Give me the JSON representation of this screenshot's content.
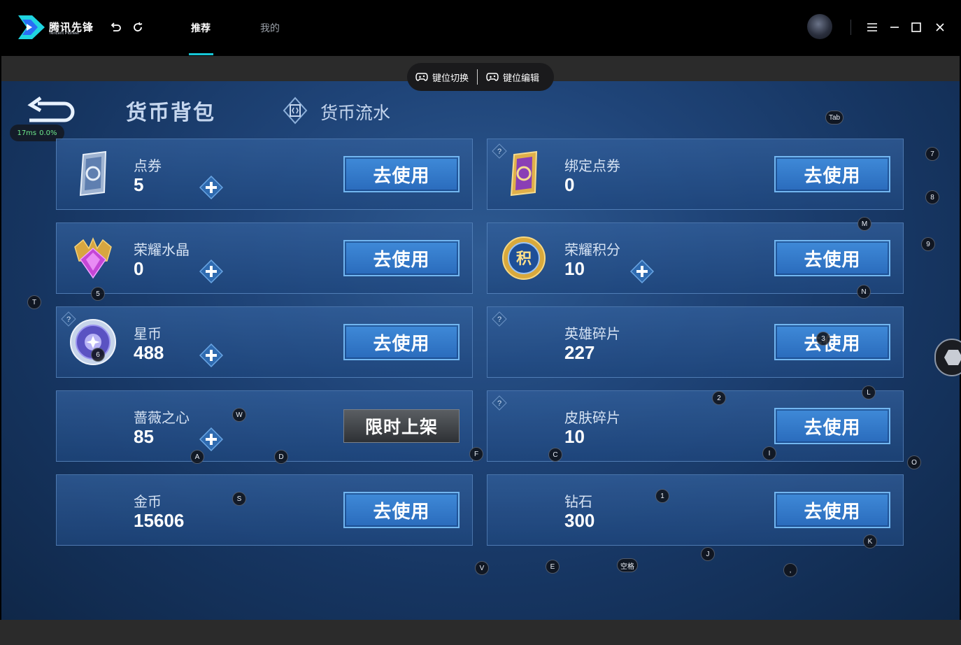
{
  "app": {
    "brand": "腾讯先锋",
    "brand_sub": "Tencent Pioneer",
    "tabs": [
      {
        "label": "推荐",
        "active": true
      },
      {
        "label": "我的",
        "active": false
      }
    ],
    "accent": "#17c6d6"
  },
  "keyctrl": {
    "switch_label": "键位切换",
    "edit_label": "键位编辑"
  },
  "ping": {
    "latency": "17ms",
    "loss": "0.0%"
  },
  "header": {
    "title": "货币背包",
    "flow_tab": "货币流水"
  },
  "currencies": [
    {
      "name": "点券",
      "value": "5",
      "action": "去使用",
      "plus": true,
      "help": false,
      "icon": "voucher-card-icon"
    },
    {
      "name": "绑定点券",
      "value": "0",
      "action": "去使用",
      "plus": false,
      "help": true,
      "icon": "bound-voucher-icon"
    },
    {
      "name": "荣耀水晶",
      "value": "0",
      "action": "去使用",
      "plus": true,
      "help": false,
      "icon": "glory-crystal-icon"
    },
    {
      "name": "荣耀积分",
      "value": "10",
      "action": "去使用",
      "plus": true,
      "help": false,
      "icon": "glory-points-icon"
    },
    {
      "name": "星币",
      "value": "488",
      "action": "去使用",
      "plus": true,
      "help": true,
      "icon": "star-coin-icon"
    },
    {
      "name": "英雄碎片",
      "value": "227",
      "action": "去使用",
      "plus": false,
      "help": true,
      "icon": ""
    },
    {
      "name": "蔷薇之心",
      "value": "85",
      "action": "限时上架",
      "plus": true,
      "help": false,
      "icon": ""
    },
    {
      "name": "皮肤碎片",
      "value": "10",
      "action": "去使用",
      "plus": false,
      "help": true,
      "icon": ""
    },
    {
      "name": "金币",
      "value": "15606",
      "action": "去使用",
      "plus": false,
      "help": false,
      "icon": ""
    },
    {
      "name": "钻石",
      "value": "300",
      "action": "去使用",
      "plus": false,
      "help": false,
      "icon": ""
    }
  ],
  "keys": {
    "tab": "Tab",
    "k7": "7",
    "k8": "8",
    "m": "M",
    "k9": "9",
    "k5": "5",
    "t": "T",
    "n": "N",
    "k6": "6",
    "k3": "3",
    "w": "W",
    "k2": "2",
    "l": "L",
    "a": "A",
    "d": "D",
    "f": "F",
    "c": "C",
    "i": "I",
    "o": "O",
    "s": "S",
    "k1": "1",
    "k": "K",
    "v": "V",
    "e": "E",
    "space": "空格",
    "j": "J",
    "comma": ","
  }
}
